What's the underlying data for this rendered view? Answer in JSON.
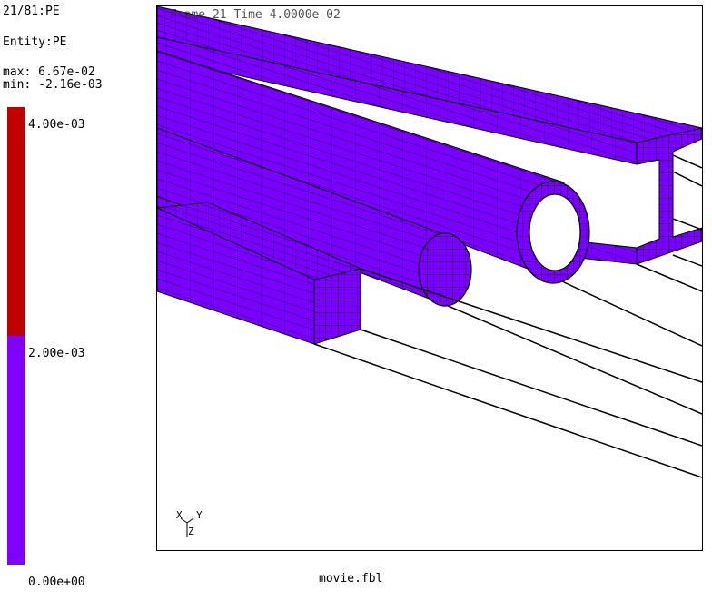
{
  "header": {
    "frame_counter": "21/81:PE",
    "entity": "Entity:PE",
    "max": "max: 6.67e-02",
    "min": "min: -2.16e-03"
  },
  "legend": {
    "levels": [
      {
        "label": "4.00e-03",
        "color": "#c00000"
      },
      {
        "label": "2.00e-03",
        "color": "#8000ff"
      },
      {
        "label": "0.00e+00"
      }
    ]
  },
  "viewport": {
    "title": "Frame 21 Time 4.0000e-02",
    "mesh_color": "#7a00ff",
    "axes": {
      "x": "X",
      "y": "Y",
      "z": "Z"
    }
  },
  "footer": {
    "filename": "movie.fbl"
  }
}
